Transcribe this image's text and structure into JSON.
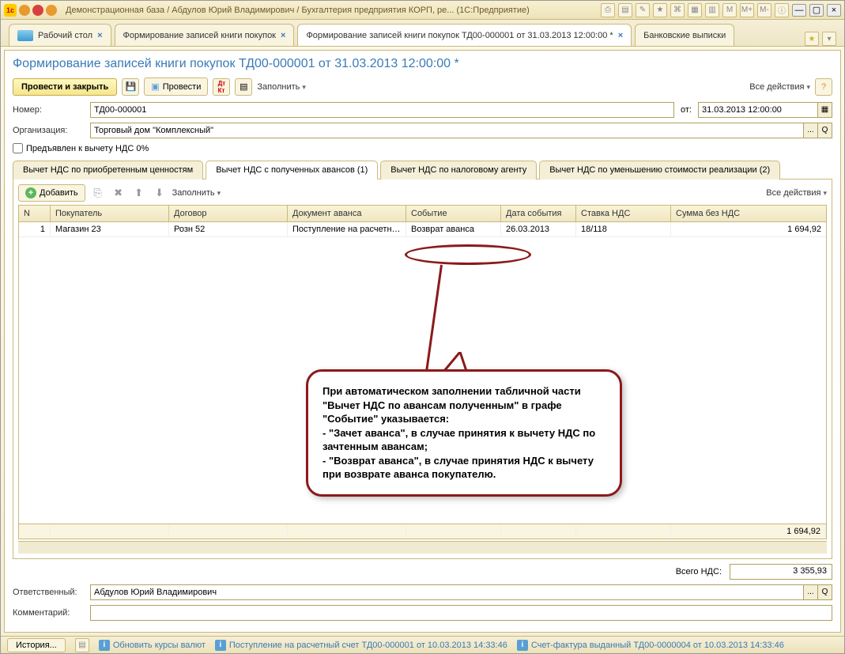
{
  "titlebar": {
    "text": "Демонстрационная база / Абдулов Юрий Владимирович / Бухгалтерия предприятия КОРП, ре...   (1С:Предприятие)",
    "badges": [
      "M",
      "M+",
      "M-"
    ]
  },
  "top_tabs": {
    "desktop": "Рабочий стол",
    "t1": "Формирование записей книги покупок",
    "t2": "Формирование записей книги покупок ТД00-000001 от 31.03.2013 12:00:00 *",
    "t3": "Банковские выписки"
  },
  "page": {
    "title": "Формирование записей книги покупок ТД00-000001 от 31.03.2013 12:00:00 *"
  },
  "toolbar": {
    "main": "Провести и закрыть",
    "provesti": "Провести",
    "fill": "Заполнить",
    "all_actions": "Все действия"
  },
  "form": {
    "number_lbl": "Номер:",
    "number_val": "ТД00-000001",
    "from_lbl": "от:",
    "date_val": "31.03.2013 12:00:00",
    "org_lbl": "Организация:",
    "org_val": "Торговый дом \"Комплексный\"",
    "checkbox": "Предъявлен к вычету НДС 0%"
  },
  "subtabs": {
    "t1": "Вычет НДС по приобретенным ценностям",
    "t2": "Вычет НДС с полученных авансов (1)",
    "t3": "Вычет НДС по налоговому агенту",
    "t4": "Вычет НДС по уменьшению стоимости реализации (2)"
  },
  "subtoolbar": {
    "add": "Добавить",
    "fill": "Заполнить",
    "all_actions": "Все действия"
  },
  "grid": {
    "headers": {
      "n": "N",
      "buyer": "Покупатель",
      "contract": "Договор",
      "doc": "Документ аванса",
      "event": "Событие",
      "date": "Дата события",
      "rate": "Ставка НДС",
      "sum": "Сумма без НДС"
    },
    "row": {
      "n": "1",
      "buyer": "Магазин 23",
      "contract": "Розн 52",
      "doc": "Поступление на расчетны...",
      "event": "Возврат аванса",
      "date": "26.03.2013",
      "rate": "18/118",
      "sum": "1 694,92"
    },
    "footer_sum": "1 694,92"
  },
  "totals": {
    "nds_lbl": "Всего НДС:",
    "nds_val": "3 355,93"
  },
  "bottom": {
    "resp_lbl": "Ответственный:",
    "resp_val": "Абдулов Юрий Владимирович",
    "comment_lbl": "Комментарий:"
  },
  "statusbar": {
    "history": "История...",
    "link1": "Обновить курсы валют",
    "link2": "Поступление на расчетный счет ТД00-000001 от 10.03.2013 14:33:46",
    "link3": "Счет-фактура выданный ТД00-0000004 от 10.03.2013 14:33:46"
  },
  "callout": {
    "l1": "При автоматическом заполнении табличной части \"Вычет НДС по авансам полученным\" в графе \"Событие\" указывается:",
    "l2": "- \"Зачет аванса\", в случае принятия к вычету НДС по зачтенным авансам;",
    "l3": "- \"Возврат аванса\", в случае принятия НДС к вычету при возврате аванса покупателю."
  }
}
